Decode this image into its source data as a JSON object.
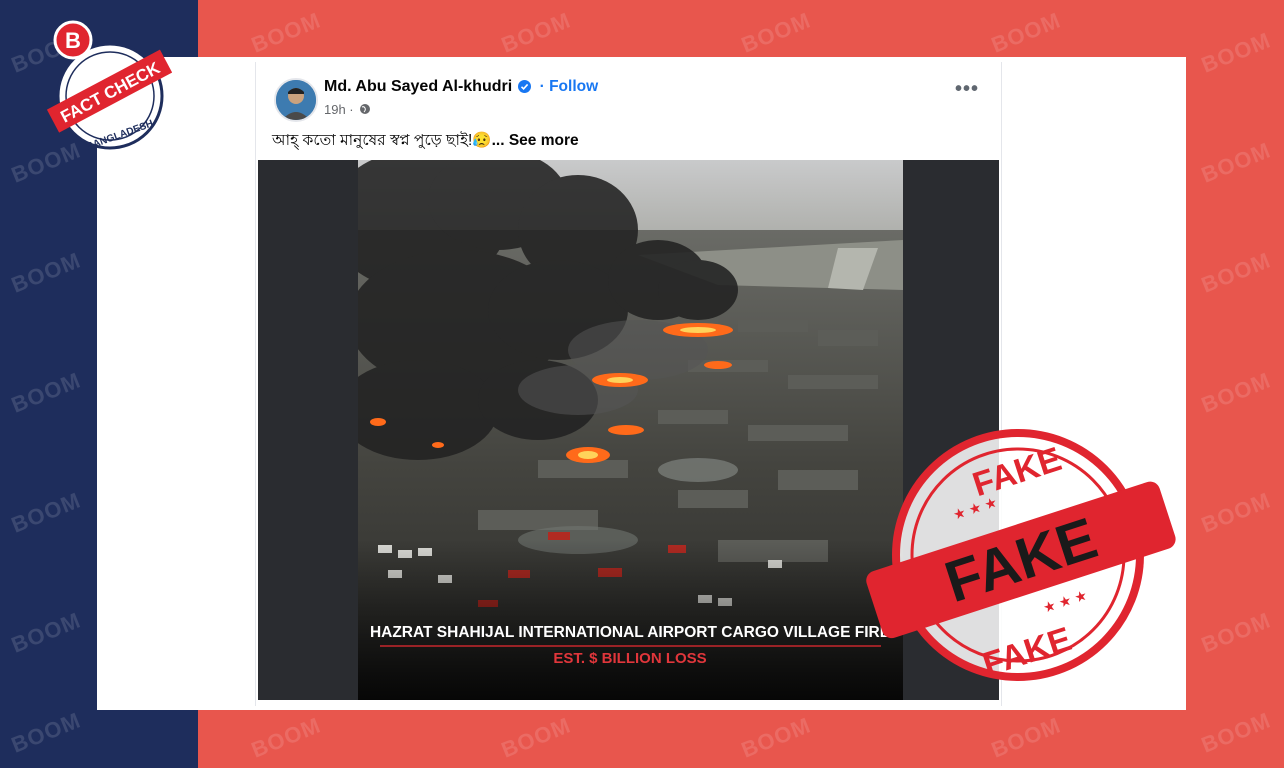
{
  "watermark": "BOOM",
  "badge": {
    "letter": "B",
    "top_text": "FACT CHECK",
    "bottom_text": "BANGLADESH"
  },
  "post": {
    "author": "Md. Abu Sayed Al-khudri",
    "follow_label": "· Follow",
    "time": "19h ·",
    "caption": "আহ্ কতো মানুষের স্বপ্ন পুড়ে ছাই!😥",
    "see_more": "... See more",
    "more_label": "•••"
  },
  "image": {
    "headline": "HAZRAT SHAHIJAL INTERNATIONAL AIRPORT CARGO VILLAGE FIRE",
    "subline": "EST. $ BILLION LOSS"
  },
  "stamp": {
    "word": "FAKE"
  },
  "colors": {
    "left_band": "#1e2d5c",
    "right_band": "#e8564d",
    "stamp": "#e0252f",
    "facebook_blue": "#1877f2"
  }
}
